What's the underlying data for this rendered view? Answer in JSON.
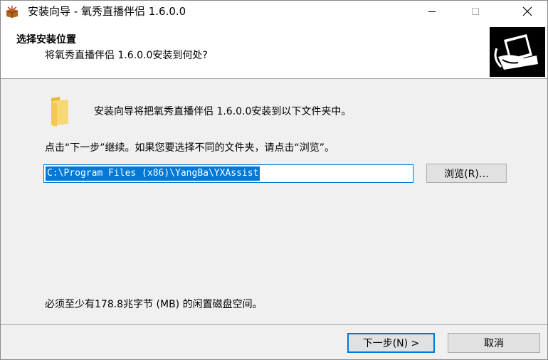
{
  "window": {
    "title": "安装向导 - 氧秀直播伴侣 1.6.0.0",
    "icon": "installer-box-icon"
  },
  "header": {
    "title": "选择安装位置",
    "subtitle": "将氧秀直播伴侣 1.6.0.0安装到何处?",
    "logo": "computer-logo-icon"
  },
  "body": {
    "intro": "安装向导将把氧秀直播伴侣 1.6.0.0安装到以下文件夹中。",
    "continue_hint": "点击“下一步”继续。如果您要选择不同的文件夹，请点击“浏览”。",
    "path_value": "C:\\Program Files (x86)\\YangBa\\YXAssist",
    "browse_label": "浏览(R)…",
    "space_required": "必须至少有178.8兆字节 (MB) 的闲置磁盘空间。"
  },
  "footer": {
    "next_label": "下一步(N) >",
    "cancel_label": "取消"
  },
  "colors": {
    "accent": "#0078d7",
    "dialog_bg": "#f0f0f0",
    "button_bg": "#e1e1e1",
    "folder": "#f8d775"
  }
}
